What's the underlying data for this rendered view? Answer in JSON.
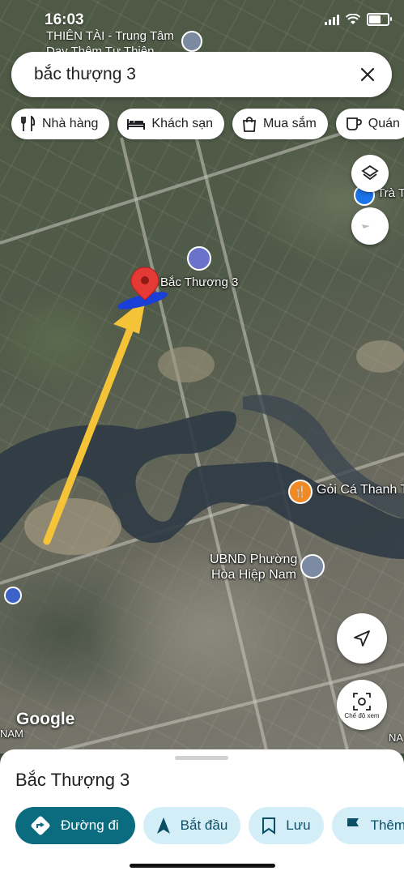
{
  "status_bar": {
    "time": "16:03"
  },
  "map": {
    "top_poi": {
      "line1": "THIÊN TÀI - Trung Tâm",
      "line2": "Dạy Thêm Tư Thiện"
    },
    "pin_label": "Bắc Thượng 3",
    "poi_right_top": "Trà T",
    "restaurant_label": "Gỏi Cá Thanh T",
    "ubnd_line1": "UBND Phường",
    "ubnd_line2": "Hòa Hiệp Nam",
    "google_label": "Google",
    "left_edge_label": "NAM",
    "right_edge_label": "NA"
  },
  "search": {
    "query": "bắc thượng 3"
  },
  "chips": [
    {
      "label": "Nhà hàng",
      "icon": "fork-knife-icon"
    },
    {
      "label": "Khách sạn",
      "icon": "bed-icon"
    },
    {
      "label": "Mua sắm",
      "icon": "shopping-bag-icon"
    },
    {
      "label": "Quán",
      "icon": "coffee-cup-icon"
    }
  ],
  "view_mode": {
    "label": "Chế độ xem"
  },
  "sheet": {
    "title": "Bắc Thượng 3",
    "actions": [
      {
        "label": "Đường đi",
        "icon": "directions-icon"
      },
      {
        "label": "Bắt đầu",
        "icon": "navigation-arrow-icon"
      },
      {
        "label": "Lưu",
        "icon": "bookmark-icon"
      },
      {
        "label": "Thêm",
        "icon": "flag-icon"
      }
    ]
  },
  "colors": {
    "primary_action": "#0b6b7f",
    "secondary_action": "#d3eef7",
    "pin": "#e53935",
    "arrow": "#f5c338",
    "marker": "#1a3fd8"
  }
}
